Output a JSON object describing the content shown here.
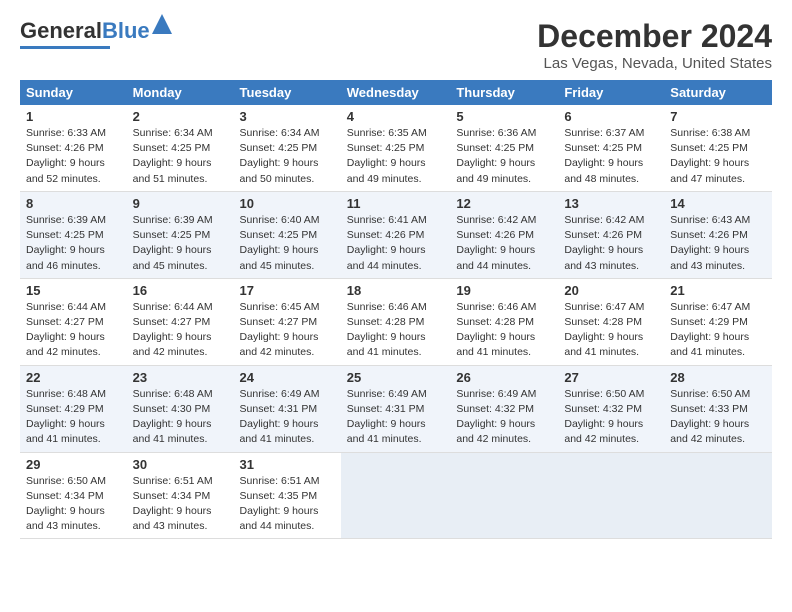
{
  "header": {
    "logo_general": "General",
    "logo_blue": "Blue",
    "title": "December 2024",
    "subtitle": "Las Vegas, Nevada, United States"
  },
  "columns": [
    "Sunday",
    "Monday",
    "Tuesday",
    "Wednesday",
    "Thursday",
    "Friday",
    "Saturday"
  ],
  "weeks": [
    [
      {
        "day": "1",
        "info": "Sunrise: 6:33 AM\nSunset: 4:26 PM\nDaylight: 9 hours\nand 52 minutes."
      },
      {
        "day": "2",
        "info": "Sunrise: 6:34 AM\nSunset: 4:25 PM\nDaylight: 9 hours\nand 51 minutes."
      },
      {
        "day": "3",
        "info": "Sunrise: 6:34 AM\nSunset: 4:25 PM\nDaylight: 9 hours\nand 50 minutes."
      },
      {
        "day": "4",
        "info": "Sunrise: 6:35 AM\nSunset: 4:25 PM\nDaylight: 9 hours\nand 49 minutes."
      },
      {
        "day": "5",
        "info": "Sunrise: 6:36 AM\nSunset: 4:25 PM\nDaylight: 9 hours\nand 49 minutes."
      },
      {
        "day": "6",
        "info": "Sunrise: 6:37 AM\nSunset: 4:25 PM\nDaylight: 9 hours\nand 48 minutes."
      },
      {
        "day": "7",
        "info": "Sunrise: 6:38 AM\nSunset: 4:25 PM\nDaylight: 9 hours\nand 47 minutes."
      }
    ],
    [
      {
        "day": "8",
        "info": "Sunrise: 6:39 AM\nSunset: 4:25 PM\nDaylight: 9 hours\nand 46 minutes."
      },
      {
        "day": "9",
        "info": "Sunrise: 6:39 AM\nSunset: 4:25 PM\nDaylight: 9 hours\nand 45 minutes."
      },
      {
        "day": "10",
        "info": "Sunrise: 6:40 AM\nSunset: 4:25 PM\nDaylight: 9 hours\nand 45 minutes."
      },
      {
        "day": "11",
        "info": "Sunrise: 6:41 AM\nSunset: 4:26 PM\nDaylight: 9 hours\nand 44 minutes."
      },
      {
        "day": "12",
        "info": "Sunrise: 6:42 AM\nSunset: 4:26 PM\nDaylight: 9 hours\nand 44 minutes."
      },
      {
        "day": "13",
        "info": "Sunrise: 6:42 AM\nSunset: 4:26 PM\nDaylight: 9 hours\nand 43 minutes."
      },
      {
        "day": "14",
        "info": "Sunrise: 6:43 AM\nSunset: 4:26 PM\nDaylight: 9 hours\nand 43 minutes."
      }
    ],
    [
      {
        "day": "15",
        "info": "Sunrise: 6:44 AM\nSunset: 4:27 PM\nDaylight: 9 hours\nand 42 minutes."
      },
      {
        "day": "16",
        "info": "Sunrise: 6:44 AM\nSunset: 4:27 PM\nDaylight: 9 hours\nand 42 minutes."
      },
      {
        "day": "17",
        "info": "Sunrise: 6:45 AM\nSunset: 4:27 PM\nDaylight: 9 hours\nand 42 minutes."
      },
      {
        "day": "18",
        "info": "Sunrise: 6:46 AM\nSunset: 4:28 PM\nDaylight: 9 hours\nand 41 minutes."
      },
      {
        "day": "19",
        "info": "Sunrise: 6:46 AM\nSunset: 4:28 PM\nDaylight: 9 hours\nand 41 minutes."
      },
      {
        "day": "20",
        "info": "Sunrise: 6:47 AM\nSunset: 4:28 PM\nDaylight: 9 hours\nand 41 minutes."
      },
      {
        "day": "21",
        "info": "Sunrise: 6:47 AM\nSunset: 4:29 PM\nDaylight: 9 hours\nand 41 minutes."
      }
    ],
    [
      {
        "day": "22",
        "info": "Sunrise: 6:48 AM\nSunset: 4:29 PM\nDaylight: 9 hours\nand 41 minutes."
      },
      {
        "day": "23",
        "info": "Sunrise: 6:48 AM\nSunset: 4:30 PM\nDaylight: 9 hours\nand 41 minutes."
      },
      {
        "day": "24",
        "info": "Sunrise: 6:49 AM\nSunset: 4:31 PM\nDaylight: 9 hours\nand 41 minutes."
      },
      {
        "day": "25",
        "info": "Sunrise: 6:49 AM\nSunset: 4:31 PM\nDaylight: 9 hours\nand 41 minutes."
      },
      {
        "day": "26",
        "info": "Sunrise: 6:49 AM\nSunset: 4:32 PM\nDaylight: 9 hours\nand 42 minutes."
      },
      {
        "day": "27",
        "info": "Sunrise: 6:50 AM\nSunset: 4:32 PM\nDaylight: 9 hours\nand 42 minutes."
      },
      {
        "day": "28",
        "info": "Sunrise: 6:50 AM\nSunset: 4:33 PM\nDaylight: 9 hours\nand 42 minutes."
      }
    ],
    [
      {
        "day": "29",
        "info": "Sunrise: 6:50 AM\nSunset: 4:34 PM\nDaylight: 9 hours\nand 43 minutes."
      },
      {
        "day": "30",
        "info": "Sunrise: 6:51 AM\nSunset: 4:34 PM\nDaylight: 9 hours\nand 43 minutes."
      },
      {
        "day": "31",
        "info": "Sunrise: 6:51 AM\nSunset: 4:35 PM\nDaylight: 9 hours\nand 44 minutes."
      },
      null,
      null,
      null,
      null
    ]
  ]
}
